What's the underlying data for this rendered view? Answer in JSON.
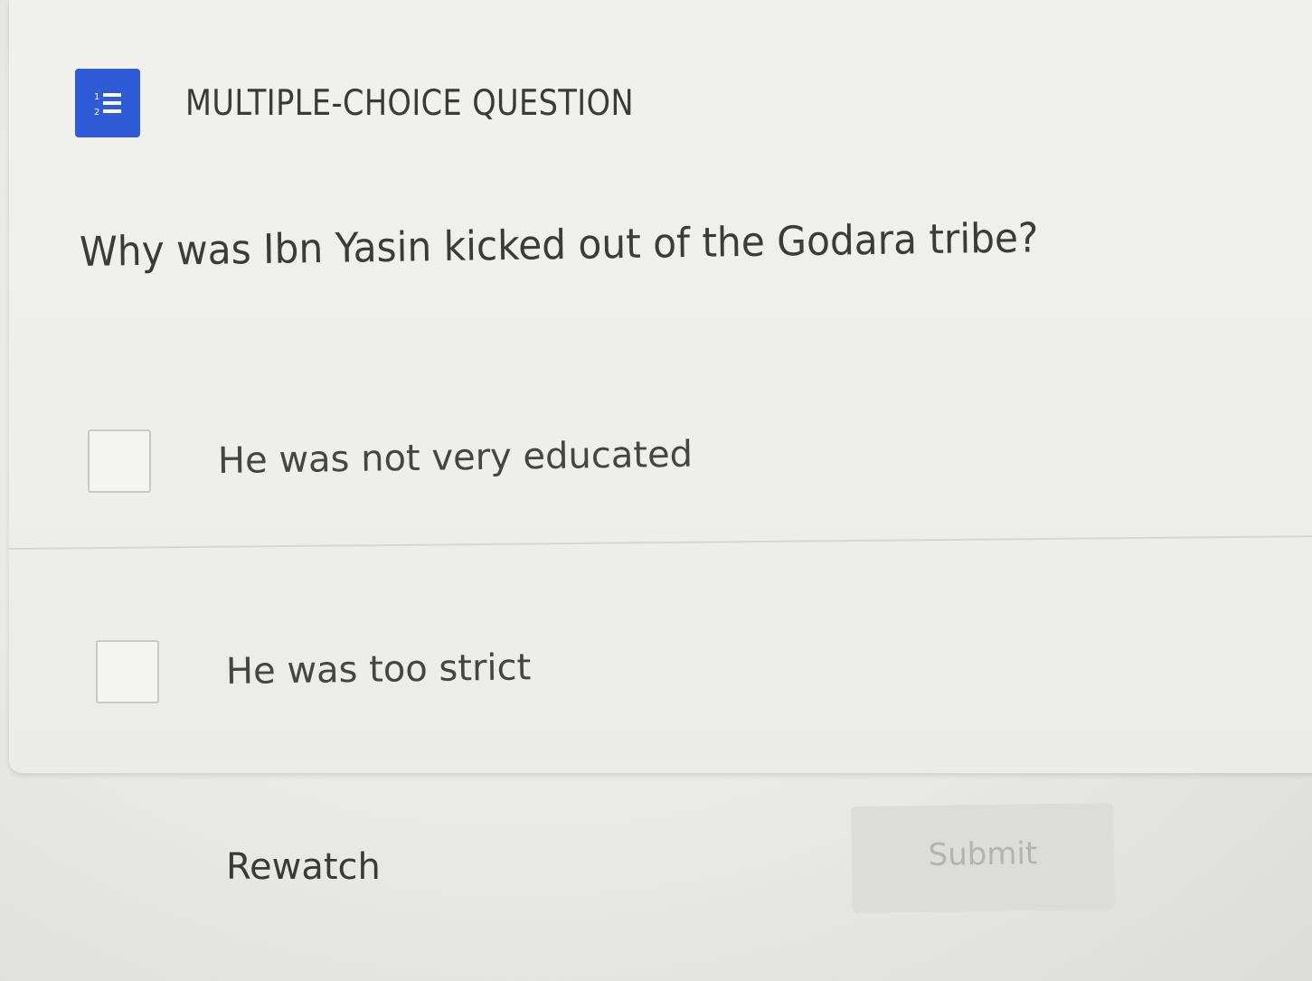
{
  "header": {
    "icon": "numbered-list-icon",
    "label": "MULTIPLE-CHOICE QUESTION",
    "icon_color": "#2f5bd6"
  },
  "question": {
    "text": "Why was Ibn Yasin kicked out of the Godara tribe?"
  },
  "options": [
    {
      "label": "He was not very educated",
      "checked": false
    },
    {
      "label": "He was too strict",
      "checked": false
    }
  ],
  "actions": {
    "rewatch_label": "Rewatch",
    "submit_label": "Submit",
    "submit_enabled": false
  }
}
